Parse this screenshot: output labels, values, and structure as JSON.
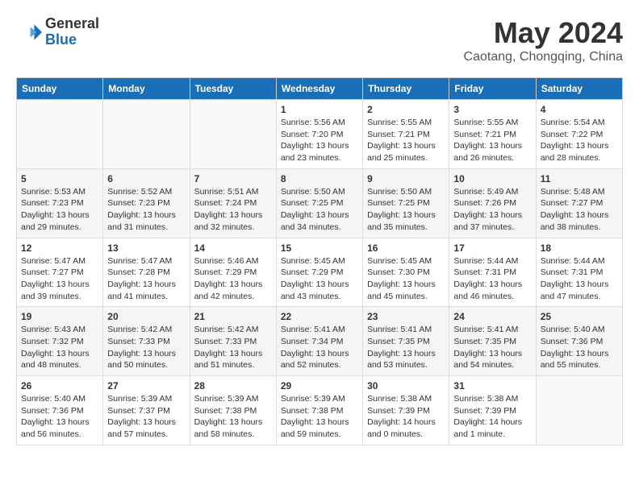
{
  "header": {
    "logo_line1": "General",
    "logo_line2": "Blue",
    "title": "May 2024",
    "location": "Caotang, Chongqing, China"
  },
  "days_of_week": [
    "Sunday",
    "Monday",
    "Tuesday",
    "Wednesday",
    "Thursday",
    "Friday",
    "Saturday"
  ],
  "weeks": [
    [
      {
        "num": "",
        "info": ""
      },
      {
        "num": "",
        "info": ""
      },
      {
        "num": "",
        "info": ""
      },
      {
        "num": "1",
        "info": "Sunrise: 5:56 AM\nSunset: 7:20 PM\nDaylight: 13 hours\nand 23 minutes."
      },
      {
        "num": "2",
        "info": "Sunrise: 5:55 AM\nSunset: 7:21 PM\nDaylight: 13 hours\nand 25 minutes."
      },
      {
        "num": "3",
        "info": "Sunrise: 5:55 AM\nSunset: 7:21 PM\nDaylight: 13 hours\nand 26 minutes."
      },
      {
        "num": "4",
        "info": "Sunrise: 5:54 AM\nSunset: 7:22 PM\nDaylight: 13 hours\nand 28 minutes."
      }
    ],
    [
      {
        "num": "5",
        "info": "Sunrise: 5:53 AM\nSunset: 7:23 PM\nDaylight: 13 hours\nand 29 minutes."
      },
      {
        "num": "6",
        "info": "Sunrise: 5:52 AM\nSunset: 7:23 PM\nDaylight: 13 hours\nand 31 minutes."
      },
      {
        "num": "7",
        "info": "Sunrise: 5:51 AM\nSunset: 7:24 PM\nDaylight: 13 hours\nand 32 minutes."
      },
      {
        "num": "8",
        "info": "Sunrise: 5:50 AM\nSunset: 7:25 PM\nDaylight: 13 hours\nand 34 minutes."
      },
      {
        "num": "9",
        "info": "Sunrise: 5:50 AM\nSunset: 7:25 PM\nDaylight: 13 hours\nand 35 minutes."
      },
      {
        "num": "10",
        "info": "Sunrise: 5:49 AM\nSunset: 7:26 PM\nDaylight: 13 hours\nand 37 minutes."
      },
      {
        "num": "11",
        "info": "Sunrise: 5:48 AM\nSunset: 7:27 PM\nDaylight: 13 hours\nand 38 minutes."
      }
    ],
    [
      {
        "num": "12",
        "info": "Sunrise: 5:47 AM\nSunset: 7:27 PM\nDaylight: 13 hours\nand 39 minutes."
      },
      {
        "num": "13",
        "info": "Sunrise: 5:47 AM\nSunset: 7:28 PM\nDaylight: 13 hours\nand 41 minutes."
      },
      {
        "num": "14",
        "info": "Sunrise: 5:46 AM\nSunset: 7:29 PM\nDaylight: 13 hours\nand 42 minutes."
      },
      {
        "num": "15",
        "info": "Sunrise: 5:45 AM\nSunset: 7:29 PM\nDaylight: 13 hours\nand 43 minutes."
      },
      {
        "num": "16",
        "info": "Sunrise: 5:45 AM\nSunset: 7:30 PM\nDaylight: 13 hours\nand 45 minutes."
      },
      {
        "num": "17",
        "info": "Sunrise: 5:44 AM\nSunset: 7:31 PM\nDaylight: 13 hours\nand 46 minutes."
      },
      {
        "num": "18",
        "info": "Sunrise: 5:44 AM\nSunset: 7:31 PM\nDaylight: 13 hours\nand 47 minutes."
      }
    ],
    [
      {
        "num": "19",
        "info": "Sunrise: 5:43 AM\nSunset: 7:32 PM\nDaylight: 13 hours\nand 48 minutes."
      },
      {
        "num": "20",
        "info": "Sunrise: 5:42 AM\nSunset: 7:33 PM\nDaylight: 13 hours\nand 50 minutes."
      },
      {
        "num": "21",
        "info": "Sunrise: 5:42 AM\nSunset: 7:33 PM\nDaylight: 13 hours\nand 51 minutes."
      },
      {
        "num": "22",
        "info": "Sunrise: 5:41 AM\nSunset: 7:34 PM\nDaylight: 13 hours\nand 52 minutes."
      },
      {
        "num": "23",
        "info": "Sunrise: 5:41 AM\nSunset: 7:35 PM\nDaylight: 13 hours\nand 53 minutes."
      },
      {
        "num": "24",
        "info": "Sunrise: 5:41 AM\nSunset: 7:35 PM\nDaylight: 13 hours\nand 54 minutes."
      },
      {
        "num": "25",
        "info": "Sunrise: 5:40 AM\nSunset: 7:36 PM\nDaylight: 13 hours\nand 55 minutes."
      }
    ],
    [
      {
        "num": "26",
        "info": "Sunrise: 5:40 AM\nSunset: 7:36 PM\nDaylight: 13 hours\nand 56 minutes."
      },
      {
        "num": "27",
        "info": "Sunrise: 5:39 AM\nSunset: 7:37 PM\nDaylight: 13 hours\nand 57 minutes."
      },
      {
        "num": "28",
        "info": "Sunrise: 5:39 AM\nSunset: 7:38 PM\nDaylight: 13 hours\nand 58 minutes."
      },
      {
        "num": "29",
        "info": "Sunrise: 5:39 AM\nSunset: 7:38 PM\nDaylight: 13 hours\nand 59 minutes."
      },
      {
        "num": "30",
        "info": "Sunrise: 5:38 AM\nSunset: 7:39 PM\nDaylight: 14 hours\nand 0 minutes."
      },
      {
        "num": "31",
        "info": "Sunrise: 5:38 AM\nSunset: 7:39 PM\nDaylight: 14 hours\nand 1 minute."
      },
      {
        "num": "",
        "info": ""
      }
    ]
  ]
}
